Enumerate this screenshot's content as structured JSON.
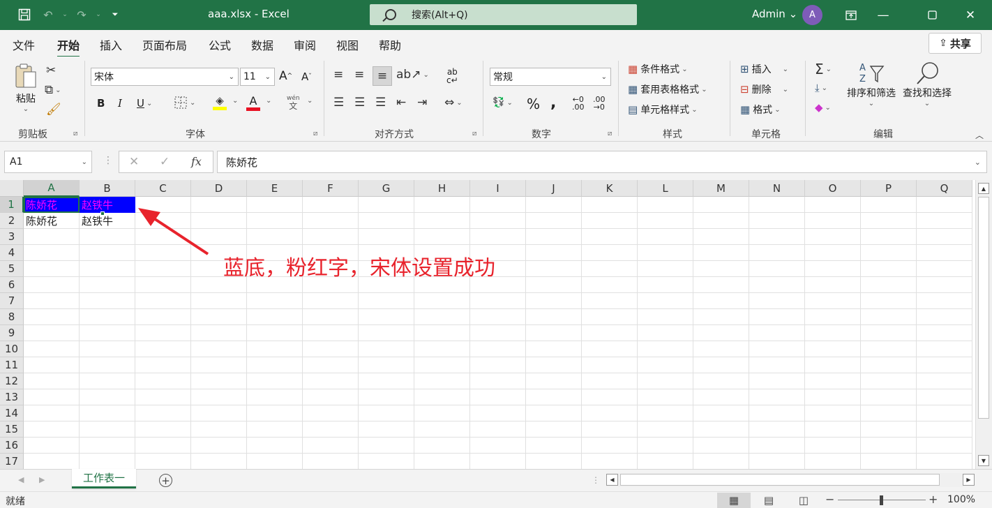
{
  "titlebar": {
    "document_title": "aaa.xlsx  -  Excel",
    "search_placeholder": "搜索(Alt+Q)",
    "user_name": "Admin ⌄",
    "avatar_initial": "A"
  },
  "menu": {
    "tabs": [
      "文件",
      "开始",
      "插入",
      "页面布局",
      "公式",
      "数据",
      "审阅",
      "视图",
      "帮助"
    ],
    "active_tab": "开始",
    "share_label": "共享"
  },
  "ribbon": {
    "clipboard": {
      "paste_label": "粘贴",
      "group_label": "剪贴板"
    },
    "font": {
      "font_name": "宋体",
      "font_size": "11",
      "group_label": "字体",
      "phonetic_top": "wén",
      "phonetic_bottom": "文"
    },
    "alignment": {
      "group_label": "对齐方式"
    },
    "number": {
      "format_value": "常规",
      "group_label": "数字"
    },
    "styles": {
      "conditional_format": "条件格式",
      "table_format": "套用表格格式",
      "cell_styles": "单元格样式",
      "group_label": "样式"
    },
    "cells": {
      "insert": "插入",
      "delete": "删除",
      "format": "格式",
      "group_label": "单元格"
    },
    "editing": {
      "sort_filter": "排序和筛选",
      "find_select": "查找和选择",
      "group_label": "编辑"
    }
  },
  "formula_bar": {
    "name_box": "A1",
    "fx_label": "fx",
    "formula_value": "陈娇花"
  },
  "grid": {
    "columns": [
      "A",
      "B",
      "C",
      "D",
      "E",
      "F",
      "G",
      "H",
      "I",
      "J",
      "K",
      "L",
      "M",
      "N",
      "O",
      "P",
      "Q"
    ],
    "rows": [
      "1",
      "2",
      "3",
      "4",
      "5",
      "6",
      "7",
      "8",
      "9",
      "10",
      "11",
      "12",
      "13",
      "14",
      "15",
      "16",
      "17"
    ],
    "cells": {
      "A1": "陈娇花",
      "B1": "赵铁牛",
      "A2": "陈娇花",
      "B2": "赵铁牛"
    },
    "styled_fill": "#0000ff",
    "styled_text": "#ff00ff"
  },
  "annotation": {
    "text": "蓝底，粉红字，宋体设置成功",
    "color": "#e8232c"
  },
  "sheets": {
    "tabs": [
      "工作表一"
    ],
    "active": "工作表一"
  },
  "statusbar": {
    "status": "就绪",
    "zoom": "100%"
  },
  "colors": {
    "accent": "#217346"
  }
}
